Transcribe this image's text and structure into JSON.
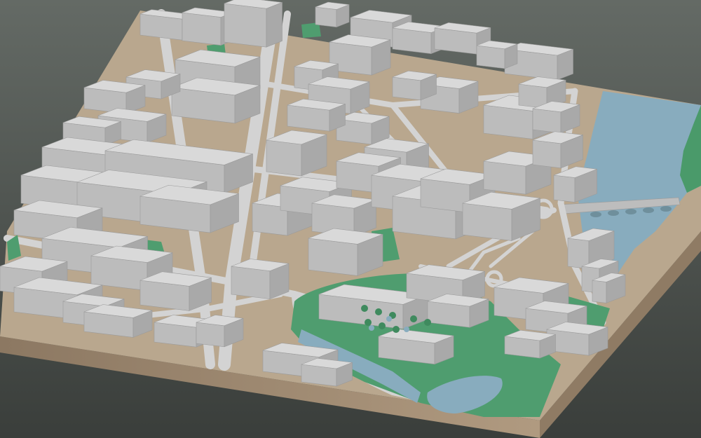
{
  "scene": {
    "description_visible_text": "",
    "colors": {
      "background_top": "#5f6560",
      "background_bottom": "#3b3f3c",
      "ground": "#b8a58c",
      "base_side": "#a08a70",
      "base_side_dark": "#7f6b55",
      "road": "#cfcfcf",
      "building_top": "#d9d9d9",
      "building_side": "#bdbdbd",
      "park": "#4d9a6e",
      "water": "#86abbd"
    }
  }
}
